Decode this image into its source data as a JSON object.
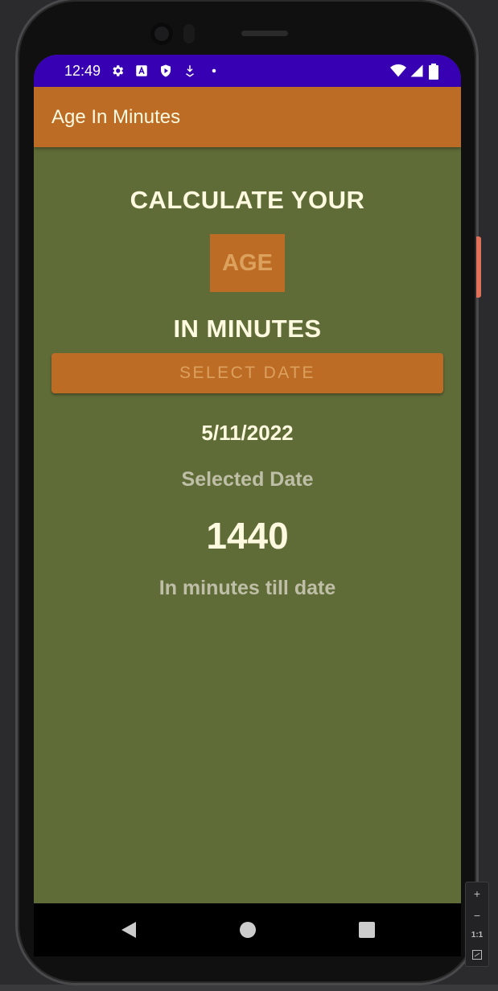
{
  "status_bar": {
    "time": "12:49",
    "left_icons": [
      "gear-icon",
      "font-a-icon",
      "shield-play-icon",
      "download-icon",
      "dot-icon"
    ],
    "right_icons": [
      "wifi-icon",
      "cellular-icon",
      "battery-icon"
    ]
  },
  "app_bar": {
    "title": "Age In Minutes"
  },
  "main": {
    "heading_top": "CALCULATE YOUR",
    "age_label": "AGE",
    "heading_bottom": "IN MINUTES",
    "select_button_label": "SELECT DATE",
    "selected_date_value": "5/11/2022",
    "selected_date_caption": "Selected Date",
    "minutes_value": "1440",
    "minutes_caption": "In minutes till date"
  },
  "nav_bar": {
    "buttons": [
      "back-icon",
      "home-icon",
      "recents-icon"
    ]
  },
  "zoom_controls": {
    "plus": "+",
    "minus": "−",
    "fit": "1:1"
  },
  "colors": {
    "status_bar": "#3700b3",
    "app_bar": "#bc6c25",
    "background": "#606c38",
    "light_text": "#fefae0",
    "accent_text": "#dda15e",
    "muted_text": "#bfbfa8"
  }
}
